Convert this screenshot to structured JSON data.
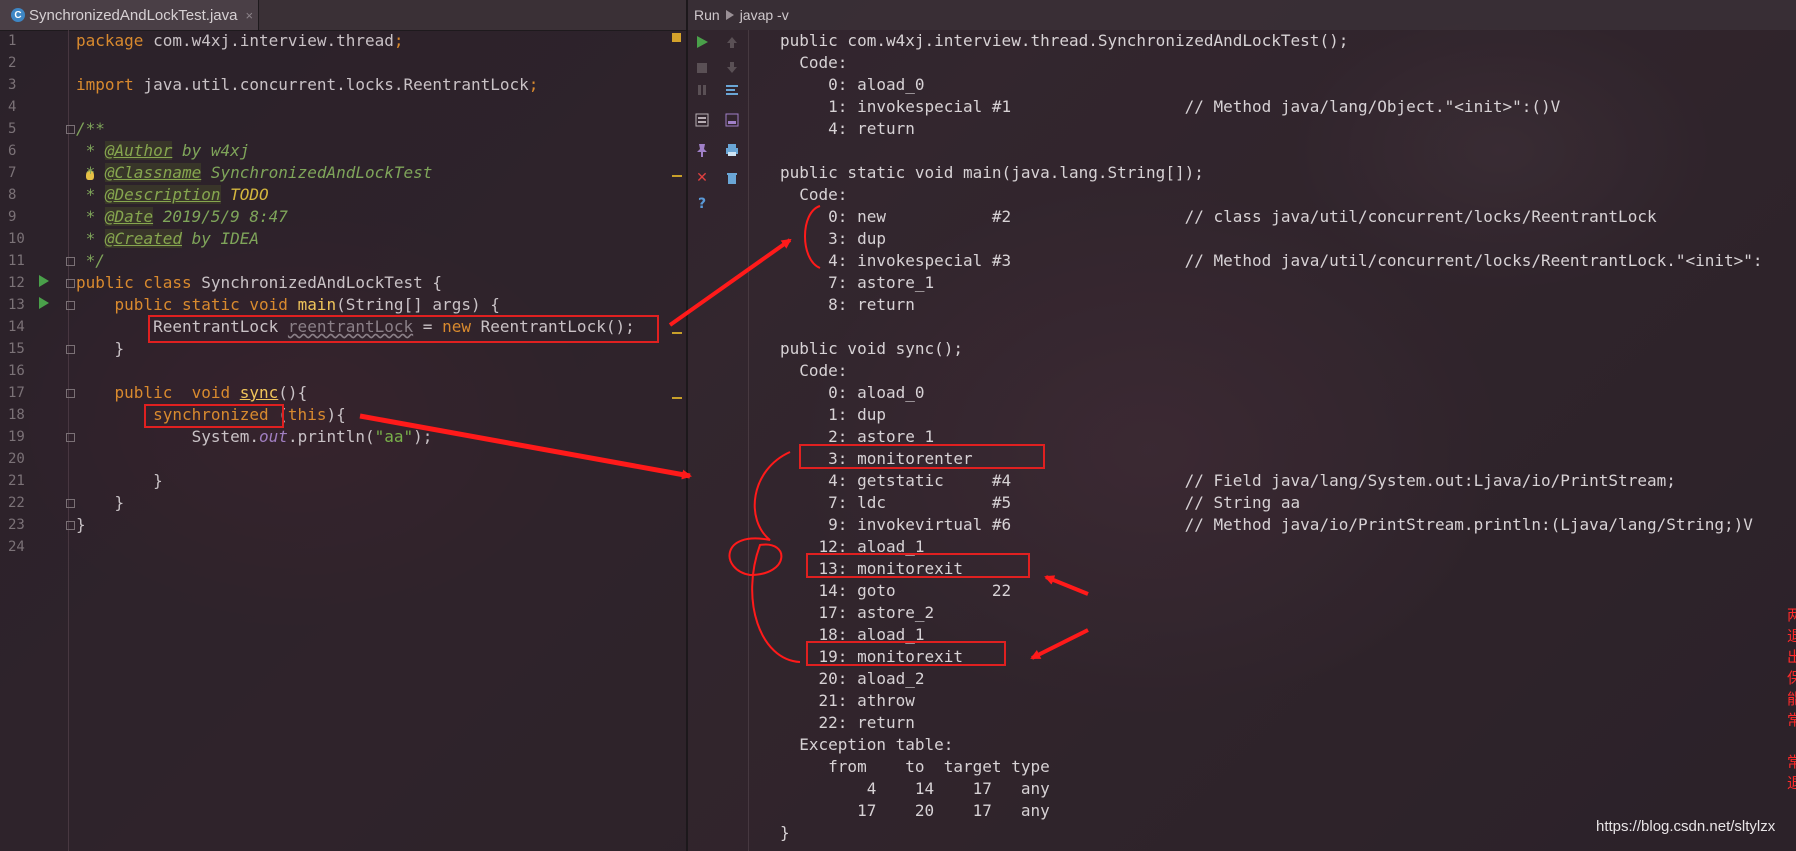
{
  "editor": {
    "tab_label": "SynchronizedAndLockTest.java",
    "tab_close": "×",
    "tab_icon": "C",
    "line_numbers": [
      "1",
      "2",
      "3",
      "4",
      "5",
      "6",
      "7",
      "8",
      "9",
      "10",
      "11",
      "12",
      "13",
      "14",
      "15",
      "16",
      "17",
      "18",
      "19",
      "20",
      "21",
      "22",
      "23",
      "24"
    ],
    "code": {
      "l1_kw": "package",
      "l1_rest": " com.w4xj.interview.thread",
      "l1_semi": ";",
      "l3_kw": "import",
      "l3_rest": " java.util.concurrent.locks.ReentrantLock",
      "l3_semi": ";",
      "l5": "/**",
      "l6_pre": " * ",
      "l6_tag": "@Author",
      "l6_rest": " by w4xj",
      "l7_pre": " * ",
      "l7_tag": "@Classname",
      "l7_rest": " SynchronizedAndLockTest",
      "l8_pre": " * ",
      "l8_tag": "@Description",
      "l8_rest": " TODO",
      "l9_pre": " * ",
      "l9_tag": "@Date",
      "l9_rest": " 2019/5/9 8:47",
      "l10_pre": " * ",
      "l10_tag": "@Created",
      "l10_rest": " by IDEA",
      "l11": " */",
      "l12_kw": "public class",
      "l12_rest": " SynchronizedAndLockTest {",
      "l13_indent": "    ",
      "l13_kw": "public static void",
      "l13_sp": " ",
      "l13_fn": "main",
      "l13_rest": "(String[] args) {",
      "l14_indent": "        ",
      "l14_type": "ReentrantLock ",
      "l14_var": "reentrantLock",
      "l14_eq": " = ",
      "l14_new": "new",
      "l14_rest": " ReentrantLock();",
      "l15": "    }",
      "l17_indent": "    ",
      "l17_kw": "public  void",
      "l17_sp": " ",
      "l17_fn": "sync",
      "l17_rest": "(){",
      "l18_indent": "        ",
      "l18_kw": "synchronized",
      "l18_sp": " (",
      "l18_this": "this",
      "l18_rest": "){",
      "l19_indent": "            System.",
      "l19_fld": "out",
      "l19_mid": ".println(",
      "l19_str": "\"aa\"",
      "l19_end": ");",
      "l21": "        }",
      "l22": "    }",
      "l23": "}"
    }
  },
  "run": {
    "label": "Run",
    "config": "javap -v",
    "lines": [
      "public com.w4xj.interview.thread.SynchronizedAndLockTest();",
      "  Code:",
      "     0: aload_0",
      "     1: invokespecial #1                  // Method java/lang/Object.\"<init>\":()V",
      "     4: return",
      "",
      "public static void main(java.lang.String[]);",
      "  Code:",
      "     0: new           #2                  // class java/util/concurrent/locks/ReentrantLock",
      "     3: dup",
      "     4: invokespecial #3                  // Method java/util/concurrent/locks/ReentrantLock.\"<init>\":",
      "     7: astore_1",
      "     8: return",
      "",
      "public void sync();",
      "  Code:",
      "     0: aload_0",
      "     1: dup",
      "     2: astore_1",
      "     3: monitorenter",
      "     4: getstatic     #4                  // Field java/lang/System.out:Ljava/io/PrintStream;",
      "     7: ldc           #5                  // String aa",
      "     9: invokevirtual #6                  // Method java/io/PrintStream.println:(Ljava/lang/String;)V",
      "    12: aload_1",
      "    13: monitorexit",
      "    14: goto          22",
      "    17: astore_2",
      "    18: aload_1",
      "    19: monitorexit",
      "    20: aload_2",
      "    21: athrow",
      "    22: return",
      "  Exception table:",
      "     from    to  target type",
      "         4    14    17   any",
      "        17    20    17   any",
      "}"
    ]
  },
  "annotation": "两次退出，保证能正常（异常）退出",
  "watermark": "https://blog.csdn.net/sltylzx",
  "colors": {
    "highlight": "#e02020",
    "keyword": "#d98a2e",
    "comment": "#7fa55a",
    "run_green": "#4aa04a"
  }
}
